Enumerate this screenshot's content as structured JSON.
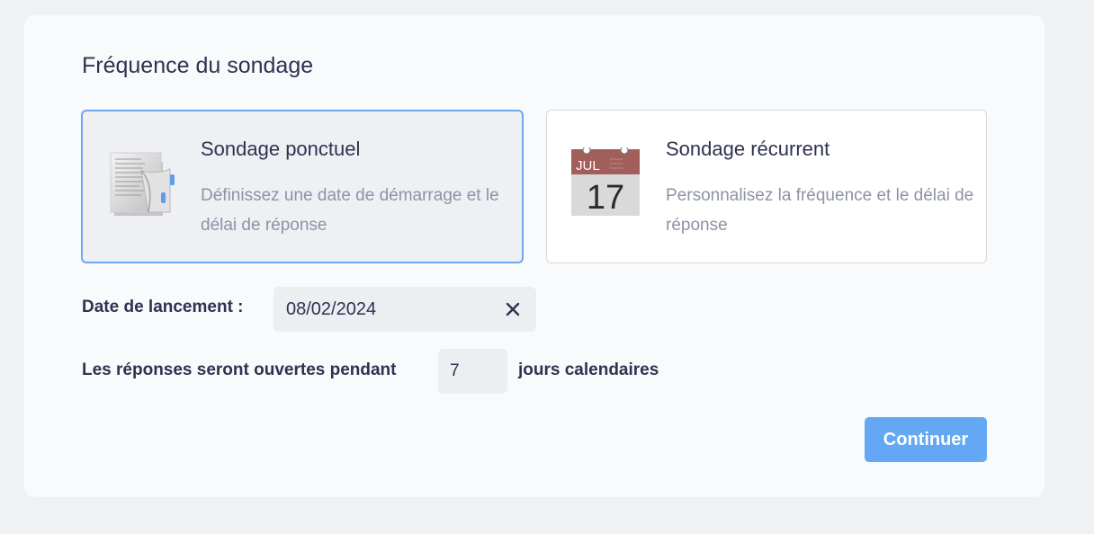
{
  "page": {
    "title": "Fréquence du sondage"
  },
  "options": [
    {
      "title": "Sondage ponctuel",
      "description": "Définissez une date de démarrage et le délai de réponse",
      "icon": "document-icon",
      "selected": true
    },
    {
      "title": "Sondage récurrent",
      "description": "Personnalisez la fréquence et le délai de réponse",
      "icon": "calendar-icon",
      "selected": false,
      "calendar_month": "JUL",
      "calendar_day": "17"
    }
  ],
  "launch": {
    "label": "Date de lancement :",
    "value": "08/02/2024"
  },
  "duration": {
    "prefix": "Les réponses seront ouvertes pendant",
    "value": "7",
    "suffix": "jours calendaires"
  },
  "actions": {
    "continue_label": "Continuer"
  },
  "colors": {
    "accent": "#64a7f4",
    "selected_border": "#6ea7ec",
    "calendar_header": "#a25e5a"
  }
}
